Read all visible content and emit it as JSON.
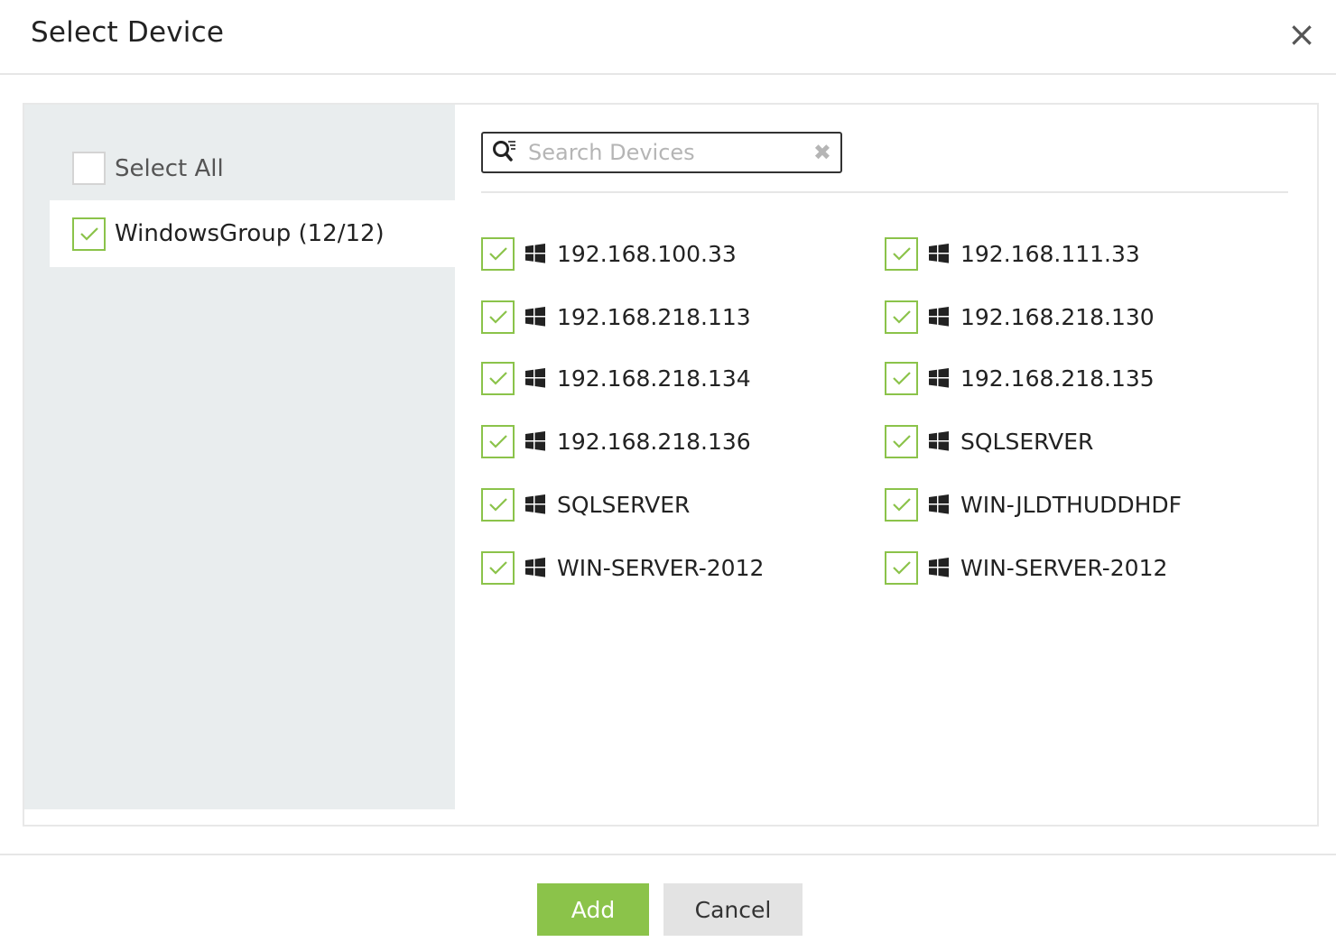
{
  "dialog": {
    "title": "Select Device",
    "close_icon": "close-icon"
  },
  "groups": {
    "select_all_label": "Select All",
    "select_all_checked": false,
    "items": [
      {
        "label": "WindowsGroup (12/12)",
        "checked": true
      }
    ]
  },
  "search": {
    "placeholder": "Search Devices",
    "value": ""
  },
  "devices": [
    {
      "name": "192.168.100.33",
      "os_icon": "windows-icon",
      "checked": true
    },
    {
      "name": "192.168.111.33",
      "os_icon": "windows-icon",
      "checked": true
    },
    {
      "name": "192.168.218.113",
      "os_icon": "windows-icon",
      "checked": true
    },
    {
      "name": "192.168.218.130",
      "os_icon": "windows-icon",
      "checked": true
    },
    {
      "name": "192.168.218.134",
      "os_icon": "windows-icon",
      "checked": true
    },
    {
      "name": "192.168.218.135",
      "os_icon": "windows-icon",
      "checked": true
    },
    {
      "name": "192.168.218.136",
      "os_icon": "windows-icon",
      "checked": true
    },
    {
      "name": "SQLSERVER",
      "os_icon": "windows-icon",
      "checked": true
    },
    {
      "name": "SQLSERVER",
      "os_icon": "windows-icon",
      "checked": true
    },
    {
      "name": "WIN-JLDTHUDDHDF",
      "os_icon": "windows-icon",
      "checked": true
    },
    {
      "name": "WIN-SERVER-2012",
      "os_icon": "windows-icon",
      "checked": true
    },
    {
      "name": "WIN-SERVER-2012",
      "os_icon": "windows-icon",
      "checked": true
    }
  ],
  "footer": {
    "add_label": "Add",
    "cancel_label": "Cancel"
  },
  "colors": {
    "accent_green": "#8bc34a",
    "panel_gray": "#e9edee"
  }
}
